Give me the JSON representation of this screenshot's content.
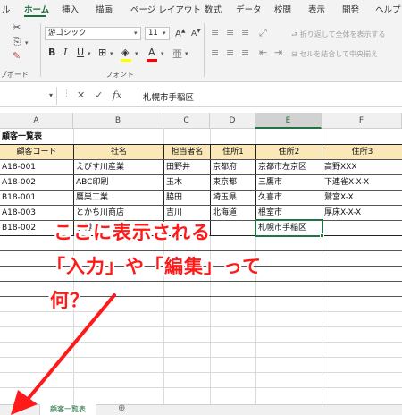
{
  "ribbon": {
    "tabs": [
      "ル",
      "ホーム",
      "挿入",
      "描画",
      "ページ レイアウト",
      "数式",
      "データ",
      "校閲",
      "表示",
      "開発",
      "ヘルプ"
    ],
    "active_tab": "ホーム",
    "font_name": "游ゴシック",
    "font_size": "11",
    "wrap_text_label": "折り返して全体を表示する",
    "merge_center_label": "セルを結合して中央揃え",
    "clipboard_group_label": "プボード",
    "font_group_label": "フォント",
    "accent_color": "#217346"
  },
  "formula_bar": {
    "cancel_icon": "cancel-icon",
    "enter_icon": "check-icon",
    "function_icon": "fx",
    "value": "札幌市手稲区"
  },
  "sheet": {
    "columns": [
      "A",
      "B",
      "C",
      "D",
      "E",
      "F"
    ],
    "active_column": "E",
    "title": "顧客一覧表",
    "headers": [
      "顧客コード",
      "社名",
      "担当者名",
      "住所1",
      "住所2",
      "住所3"
    ],
    "rows": [
      [
        "A18-001",
        "えびす川産業",
        "田野井",
        "京都府",
        "京都市左京区",
        "高野XXX"
      ],
      [
        "A18-002",
        "ABC印刷",
        "玉木",
        "東京都",
        "三鷹市",
        "下連雀X-X-X"
      ],
      [
        "B18-001",
        "鷹巣工業",
        "脇田",
        "埼玉県",
        "久喜市",
        "鷲宮X-X"
      ],
      [
        "A18-003",
        "とかち川商店",
        "吉川",
        "北海道",
        "根室市",
        "厚床X-X-X"
      ],
      [
        "B18-002",
        "小樽",
        "",
        "",
        "札幌市手稲区",
        ""
      ]
    ],
    "tab_name": "顧客一覧表"
  },
  "annotation": {
    "line1": "ここに表示される",
    "line2": "「入力」や「編集」って",
    "line3": "何？",
    "color": "#ff1a1a"
  }
}
